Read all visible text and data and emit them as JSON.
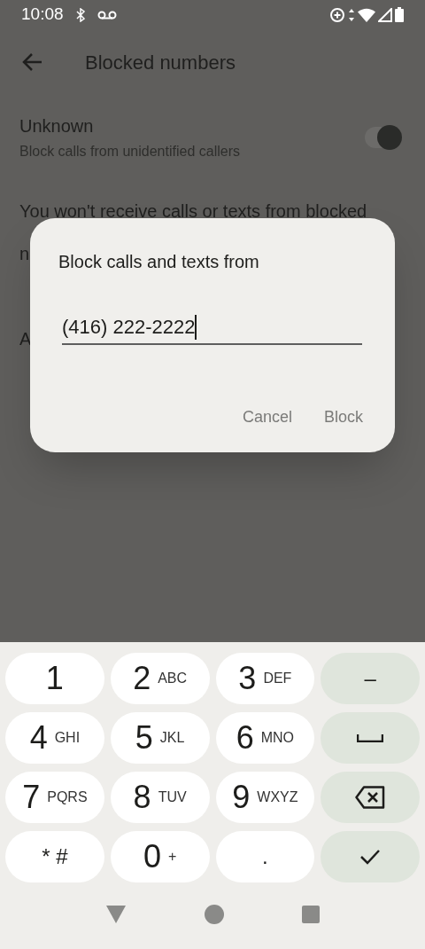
{
  "status_bar": {
    "time": "10:08"
  },
  "toolbar": {
    "title": "Blocked numbers"
  },
  "unknown_setting": {
    "title": "Unknown",
    "subtitle": "Block calls from unidentified callers",
    "on": true
  },
  "background_text": [
    "You won't receive calls or texts from blocked",
    "n",
    "A"
  ],
  "dialog": {
    "title": "Block calls and texts from",
    "value": "(416) 222-2222",
    "buttons": [
      "Cancel",
      "Block"
    ]
  },
  "keypad": [
    {
      "kind": "digit",
      "digit": "1"
    },
    {
      "kind": "digit",
      "digit": "2",
      "letters": "ABC"
    },
    {
      "kind": "digit",
      "digit": "3",
      "letters": "DEF"
    },
    {
      "kind": "text",
      "label": "–"
    },
    {
      "kind": "digit",
      "digit": "4",
      "letters": "GHI"
    },
    {
      "kind": "digit",
      "digit": "5",
      "letters": "JKL"
    },
    {
      "kind": "digit",
      "digit": "6",
      "letters": "MNO"
    },
    {
      "kind": "space"
    },
    {
      "kind": "digit",
      "digit": "7",
      "letters": "PQRS"
    },
    {
      "kind": "digit",
      "digit": "8",
      "letters": "TUV"
    },
    {
      "kind": "digit",
      "digit": "9",
      "letters": "WXYZ"
    },
    {
      "kind": "backspace"
    },
    {
      "kind": "symbol",
      "label": "* #"
    },
    {
      "kind": "digit",
      "digit": "0",
      "letters": "+"
    },
    {
      "kind": "symbol",
      "label": "."
    },
    {
      "kind": "done"
    }
  ]
}
